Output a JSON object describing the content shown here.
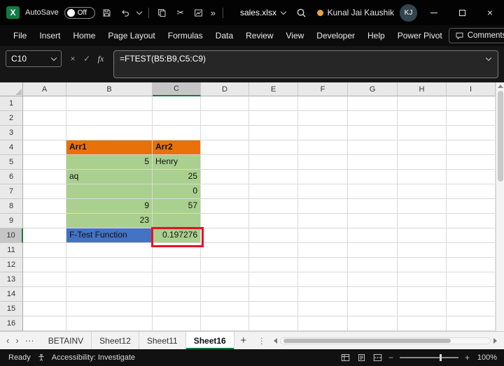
{
  "colors": {
    "excel_green": "#107C41",
    "cell_orange": "#E8710A",
    "cell_green": "#A9D08E",
    "cell_blue": "#4472C4",
    "annotation_red": "#E81123",
    "presence_dot": "#E8A33D",
    "avatar_bg": "#33454E"
  },
  "titlebar": {
    "autosave_label": "AutoSave",
    "autosave_state": "Off",
    "filename": "sales.xlsx",
    "user_name": "Kunal Jai Kaushik",
    "user_initials": "KJ"
  },
  "ribbon": {
    "tabs": [
      "File",
      "Insert",
      "Home",
      "Page Layout",
      "Formulas",
      "Data",
      "Review",
      "View",
      "Developer",
      "Help",
      "Power Pivot"
    ],
    "comments_label": "Comments"
  },
  "formula_bar": {
    "name_box": "C10",
    "fx_label": "fx",
    "formula": "=FTEST(B5:B9,C5:C9)"
  },
  "grid": {
    "column_headers": [
      "A",
      "B",
      "C",
      "D",
      "E",
      "F",
      "G",
      "H",
      "I"
    ],
    "row_headers": [
      "1",
      "2",
      "3",
      "4",
      "5",
      "6",
      "7",
      "8",
      "9",
      "10",
      "11",
      "12",
      "13",
      "14",
      "15",
      "16"
    ],
    "selected_column": "C",
    "selected_row": "10",
    "active_cell": "C10",
    "cells": [
      {
        "ref": "B4",
        "text": "Arr1",
        "bg": "orange",
        "bold": true,
        "align": "left"
      },
      {
        "ref": "C4",
        "text": "Arr2",
        "bg": "orange",
        "bold": true,
        "align": "left"
      },
      {
        "ref": "B5",
        "text": "5",
        "bg": "green",
        "align": "right"
      },
      {
        "ref": "C5",
        "text": "Henry",
        "bg": "green",
        "align": "left"
      },
      {
        "ref": "B6",
        "text": "aq",
        "bg": "green",
        "align": "left"
      },
      {
        "ref": "C6",
        "text": "25",
        "bg": "green",
        "align": "right"
      },
      {
        "ref": "B7",
        "text": "",
        "bg": "green",
        "align": "left"
      },
      {
        "ref": "C7",
        "text": "0",
        "bg": "green",
        "align": "right"
      },
      {
        "ref": "B8",
        "text": "9",
        "bg": "green",
        "align": "right"
      },
      {
        "ref": "C8",
        "text": "57",
        "bg": "green",
        "align": "right"
      },
      {
        "ref": "B9",
        "text": "23",
        "bg": "green",
        "align": "right"
      },
      {
        "ref": "C9",
        "text": "",
        "bg": "green",
        "align": "left"
      },
      {
        "ref": "B10",
        "text": "F-Test Function",
        "bg": "blue",
        "align": "left"
      },
      {
        "ref": "C10",
        "text": "0.197276",
        "bg": "green",
        "align": "right",
        "highlight": true
      }
    ]
  },
  "sheet_tabs": {
    "tabs": [
      {
        "label": "BETAINV",
        "active": false
      },
      {
        "label": "Sheet12",
        "active": false
      },
      {
        "label": "Sheet11",
        "active": false
      },
      {
        "label": "Sheet16",
        "active": true
      }
    ]
  },
  "status_bar": {
    "ready_label": "Ready",
    "accessibility_label": "Accessibility: Investigate",
    "zoom_level": "100%"
  },
  "glyphs": {
    "more_commands": "»",
    "tab_scroll_left": "‹",
    "tab_scroll_right": "›",
    "tab_list": "···",
    "add_sheet": "+",
    "close": "×",
    "cancel": "×",
    "enter": "✓",
    "zoom_out": "−",
    "zoom_in": "+",
    "vertical_more": "⋮",
    "logo_letter": "X"
  }
}
